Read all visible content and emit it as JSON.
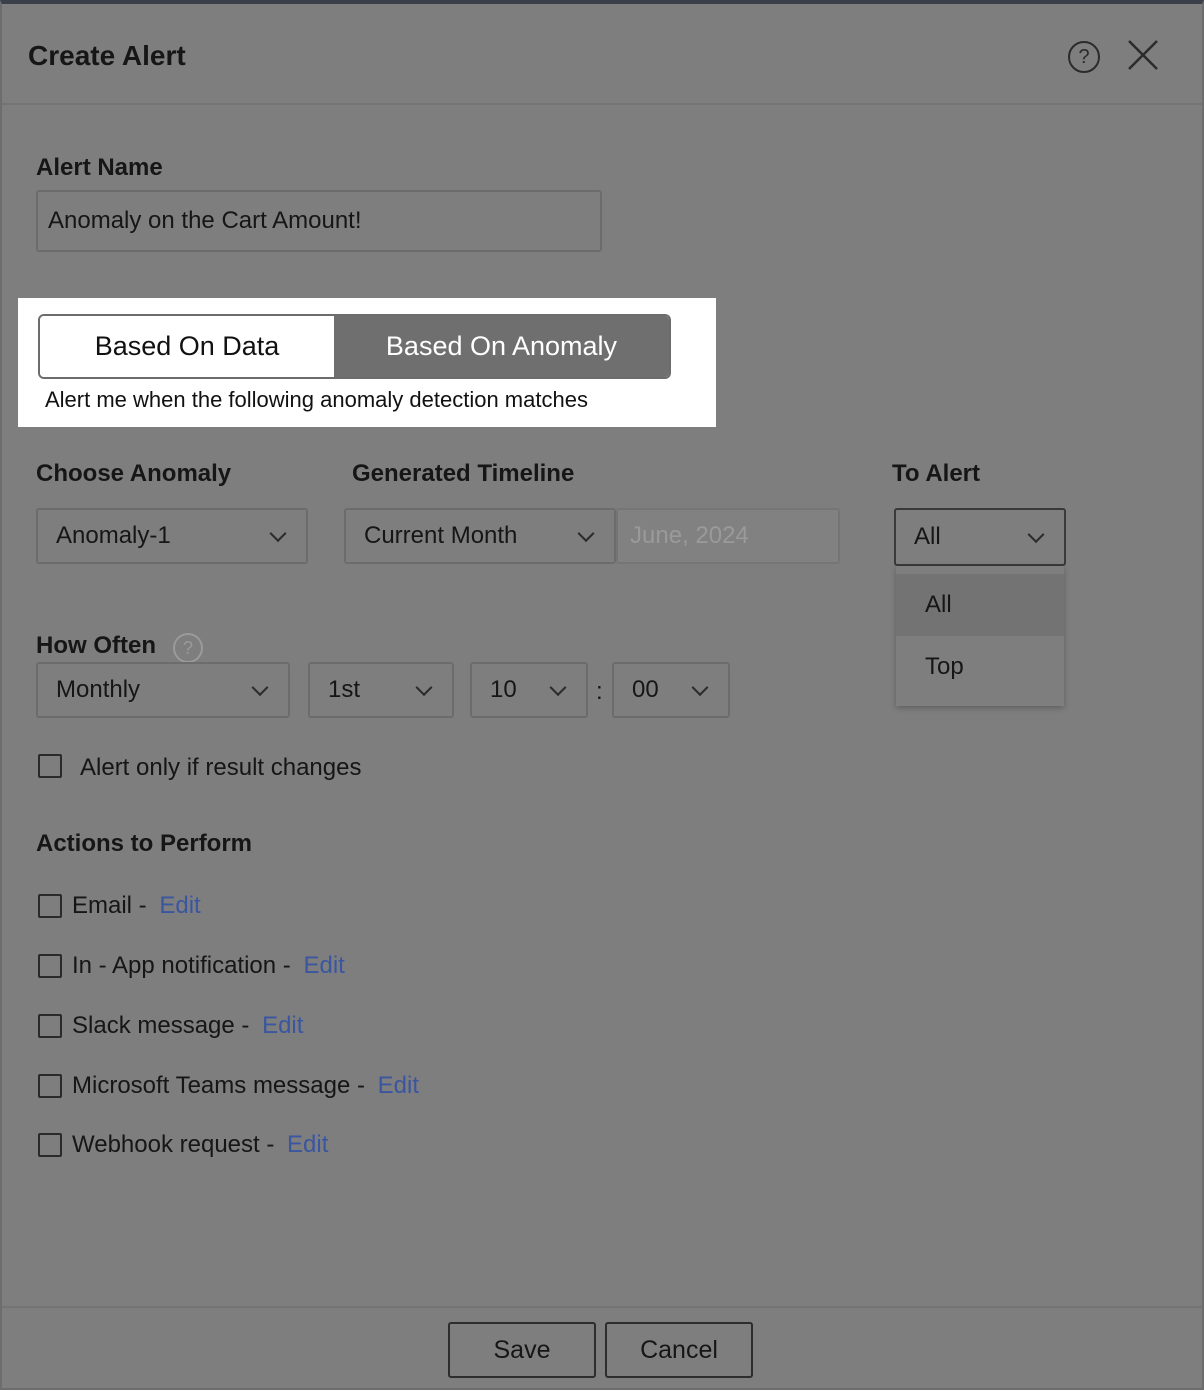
{
  "dialog": {
    "title": "Create Alert",
    "help_icon_glyph": "?",
    "help_icon": "question-circle-icon",
    "close_icon": "close-icon"
  },
  "alert_name": {
    "label": "Alert Name",
    "value": "Anomaly on the Cart Amount!"
  },
  "mode_toggle": {
    "options": [
      "Based On Data",
      "Based On Anomaly"
    ],
    "selected": "Based On Anomaly",
    "description": "Alert me when the following anomaly detection matches"
  },
  "choose_anomaly": {
    "label": "Choose Anomaly",
    "value": "Anomaly-1"
  },
  "generated_timeline": {
    "label": "Generated Timeline",
    "value": "Current Month",
    "period": "June, 2024"
  },
  "to_alert": {
    "label": "To Alert",
    "value": "All",
    "options": [
      "All",
      "Top"
    ]
  },
  "how_often": {
    "label": "How Often",
    "help_glyph": "?",
    "frequency": "Monthly",
    "day": "1st",
    "hour": "10",
    "separator": ":",
    "minute": "00"
  },
  "alert_only_changes": {
    "label": "Alert only if result changes",
    "checked": false
  },
  "actions": {
    "title": "Actions to Perform",
    "edit_label": "Edit",
    "items": [
      {
        "label": "Email - ",
        "checked": false
      },
      {
        "label": "In - App notification - ",
        "checked": false
      },
      {
        "label": "Slack message - ",
        "checked": false
      },
      {
        "label": "Microsoft Teams message - ",
        "checked": false
      },
      {
        "label": "Webhook request - ",
        "checked": false
      }
    ]
  },
  "footer": {
    "save_label": "Save",
    "cancel_label": "Cancel"
  },
  "colors": {
    "overlay": "#7e7e7e",
    "toggle_active": "#6f6f70",
    "link": "#3a56a0"
  }
}
